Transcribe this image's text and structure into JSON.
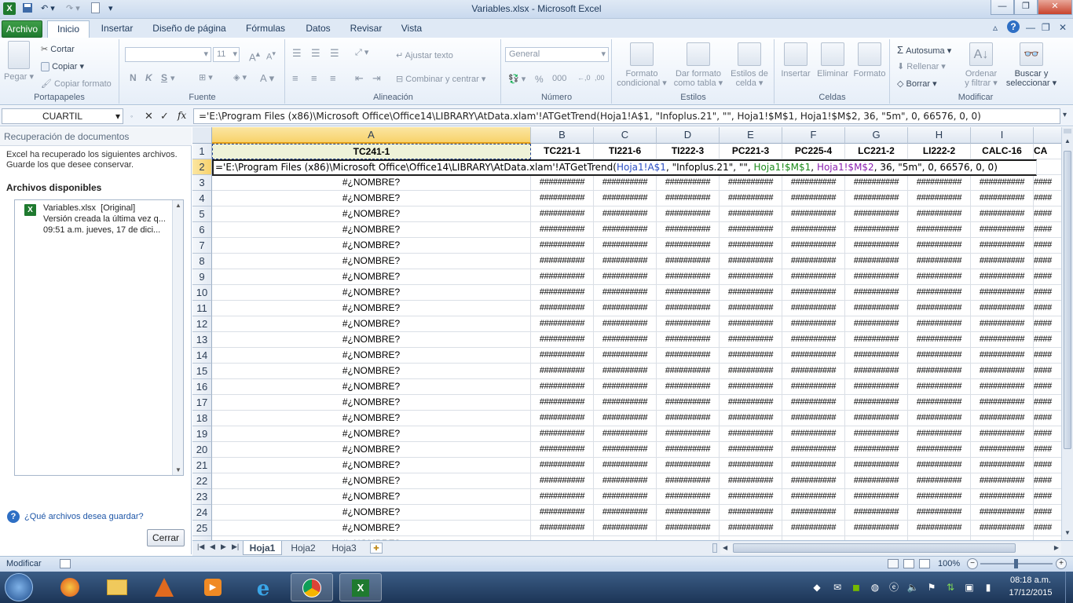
{
  "window": {
    "title": "Variables.xlsx - Microsoft Excel"
  },
  "qat": {
    "save_icon": "save-icon",
    "undo_icon": "undo-icon",
    "redo_icon": "redo-icon"
  },
  "tabs": [
    "Archivo",
    "Inicio",
    "Insertar",
    "Diseño de página",
    "Fórmulas",
    "Datos",
    "Revisar",
    "Vista"
  ],
  "ribbon": {
    "clipboard": {
      "label": "Portapapeles",
      "paste": "Pegar",
      "cut": "Cortar",
      "copy": "Copiar",
      "format_painter": "Copiar formato"
    },
    "font": {
      "label": "Fuente",
      "size": "11",
      "bold": "N",
      "italic": "K",
      "underline": "S"
    },
    "alignment": {
      "label": "Alineación",
      "wrap": "Ajustar texto",
      "merge": "Combinar y centrar"
    },
    "number": {
      "label": "Número",
      "format": "General",
      "percent": "%",
      "thousands": "000"
    },
    "styles": {
      "label": "Estilos",
      "conditional_1": "Formato",
      "conditional_2": "condicional",
      "table_1": "Dar formato",
      "table_2": "como tabla",
      "cell_styles_1": "Estilos de",
      "cell_styles_2": "celda"
    },
    "cells": {
      "label": "Celdas",
      "insert": "Insertar",
      "delete": "Eliminar",
      "format": "Formato"
    },
    "editing": {
      "label": "Modificar",
      "autosum": "Autosuma",
      "fill": "Rellenar",
      "clear": "Borrar",
      "sort_1": "Ordenar",
      "sort_2": "y filtrar",
      "find_1": "Buscar y",
      "find_2": "seleccionar"
    }
  },
  "formula_bar": {
    "name_box": "CUARTIL",
    "cancel": "✕",
    "enter": "✓",
    "fx": "fx",
    "formula": "='E:\\Program Files (x86)\\Microsoft Office\\Office14\\LIBRARY\\AtData.xlam'!ATGetTrend(Hoja1!A$1, \"Infoplus.21\", \"\", Hoja1!$M$1, Hoja1!$M$2, 36, \"5m\", 0, 66576, 0, 0)"
  },
  "task_pane": {
    "title": "Recuperación de documentos",
    "message_1": "Excel ha recuperado los siguientes archivos.",
    "message_2": "Guarde los que desee conservar.",
    "available": "Archivos disponibles",
    "file": {
      "name": "Variables.xlsx  [Original]",
      "line2": "Versión creada la última vez q...",
      "line3": "09:51 a.m. jueves, 17 de dici..."
    },
    "help_link": "¿Qué archivos desea guardar?",
    "close_button": "Cerrar"
  },
  "sheet": {
    "column_letters": [
      "A",
      "B",
      "C",
      "D",
      "E",
      "F",
      "G",
      "H",
      "I"
    ],
    "header_row": [
      "TC241-1",
      "TC221-1",
      "TI221-6",
      "TI222-3",
      "PC221-3",
      "PC225-4",
      "LC221-2",
      "LI222-2",
      "CALC-16",
      "CA"
    ],
    "row2_edit": {
      "prefix": "='E:\\Program Files (x86)\\Microsoft Office\\Office14\\LIBRARY\\AtData.xlam'!ATGetTrend(",
      "ref1": "Hoja1!A$1",
      "mid1": ", \"Infoplus.21\", \"\", ",
      "ref2": "Hoja1!$M$1",
      "mid2": ", ",
      "ref3": "Hoja1!$M$2",
      "suffix": ", 36, \"5m\", 0, 66576, 0, 0)"
    },
    "row_numbers": [
      "1",
      "2",
      "3",
      "4",
      "5",
      "6",
      "7",
      "8",
      "9",
      "10",
      "11",
      "12",
      "13",
      "14",
      "15",
      "16",
      "17",
      "18",
      "19",
      "20",
      "21",
      "22",
      "23",
      "24",
      "25"
    ],
    "error_value": "#¿NOMBRE?",
    "overflow_value": "##########",
    "overflow_value_short": "####",
    "ref_colors": [
      "#2a4ec4",
      "#1a8a1a",
      "#8a1fb0"
    ]
  },
  "sheet_tabs": [
    "Hoja1",
    "Hoja2",
    "Hoja3"
  ],
  "status": {
    "mode": "Modificar",
    "zoom": "100%"
  },
  "taskbar": {
    "time": "08:18 a.m.",
    "date": "17/12/2015"
  }
}
